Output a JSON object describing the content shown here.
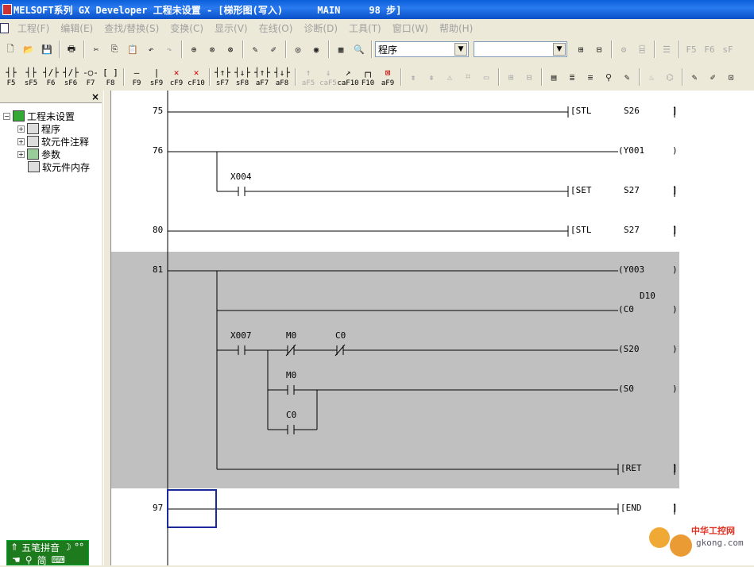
{
  "window": {
    "title": "MELSOFT系列 GX Developer 工程未设置 - [梯形图(写入)      MAIN     98 步]"
  },
  "menu": [
    "工程(F)",
    "编辑(E)",
    "查找/替换(S)",
    "变换(C)",
    "显示(V)",
    "在线(O)",
    "诊断(D)",
    "工具(T)",
    "窗口(W)",
    "帮助(H)"
  ],
  "toolbar": {
    "program_combo": "程序",
    "second_combo": ""
  },
  "fkeys": [
    {
      "sym": "┤├",
      "key": "F5"
    },
    {
      "sym": "┤├",
      "key": "sF5"
    },
    {
      "sym": "┤/├",
      "key": "F6"
    },
    {
      "sym": "┤/├",
      "key": "sF6"
    },
    {
      "sym": "-○-",
      "key": "F7"
    },
    {
      "sym": "[ ]",
      "key": "F8"
    },
    {
      "sym": "—",
      "key": "F9"
    },
    {
      "sym": "|",
      "key": "sF9"
    },
    {
      "sym": "✕",
      "key": "cF9"
    },
    {
      "sym": "✕",
      "key": "cF10"
    },
    {
      "sym": "┤↑├",
      "key": "sF7"
    },
    {
      "sym": "┤↓├",
      "key": "sF8"
    },
    {
      "sym": "┤↑├",
      "key": "aF7"
    },
    {
      "sym": "┤↓├",
      "key": "aF8"
    },
    {
      "sym": "↑",
      "key": "aF5"
    },
    {
      "sym": "↓",
      "key": "caF5"
    },
    {
      "sym": "↗",
      "key": "caF10"
    },
    {
      "sym": "┌┐",
      "key": "F10"
    },
    {
      "sym": "⊠",
      "key": "aF9"
    }
  ],
  "tree": {
    "root": "工程未设置",
    "items": [
      "程序",
      "软元件注释",
      "参数",
      "软元件内存"
    ]
  },
  "ladder": {
    "steps": [
      "75",
      "76",
      "80",
      "81",
      "97"
    ],
    "rows": [
      {
        "step": "75",
        "instr": "[STL",
        "operand": "S26"
      },
      {
        "step": "76",
        "coil": "(Y001"
      },
      {
        "contact": "X004",
        "instr": "[SET",
        "operand": "S27"
      },
      {
        "step": "80",
        "instr": "[STL",
        "operand": "S27"
      },
      {
        "step": "81",
        "coil": "(Y003"
      },
      {
        "coil": "(C0",
        "const": "D10"
      },
      {
        "contacts": [
          "X007",
          "M0",
          "C0"
        ],
        "coil": "(S20"
      },
      {
        "contact": "M0",
        "coil": "(S0"
      },
      {
        "contact": "C0"
      },
      {
        "instr": "[RET"
      },
      {
        "step": "97",
        "instr": "[END"
      }
    ]
  },
  "ime": {
    "line1": "五笔拼音",
    "line2": "简"
  },
  "watermark": {
    "brand": "中华工控网",
    "url": "gkong.com"
  }
}
